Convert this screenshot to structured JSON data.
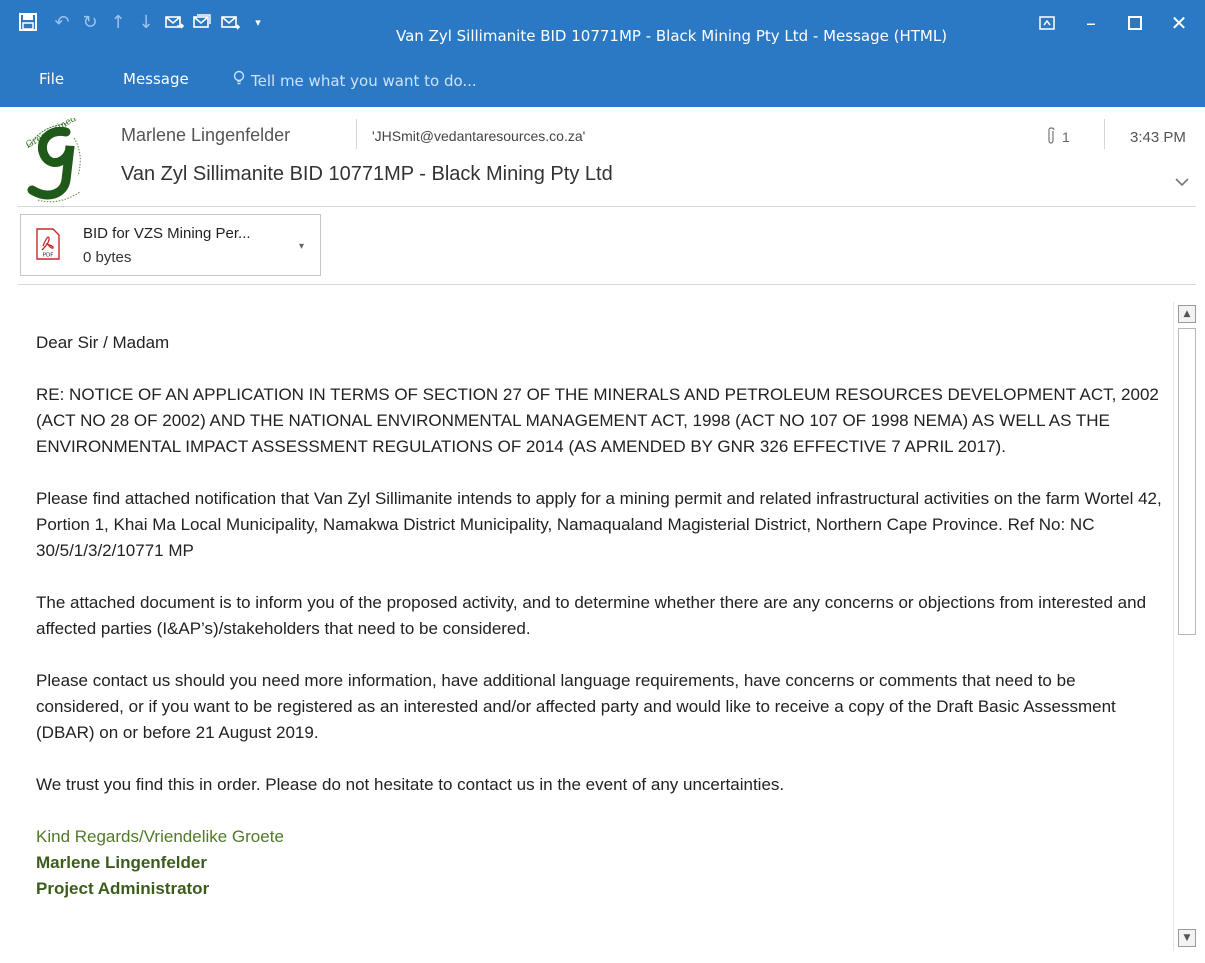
{
  "window": {
    "title": "Van Zyl Sillimanite BID 10771MP - Black Mining Pty Ltd - Message (HTML)",
    "accent": "#2b78c5"
  },
  "quick_access": [
    {
      "icon": "save-icon"
    },
    {
      "icon": "undo-icon"
    },
    {
      "icon": "redo-icon"
    },
    {
      "icon": "up-arrow-icon"
    },
    {
      "icon": "down-arrow-icon"
    },
    {
      "icon": "reply-icon"
    },
    {
      "icon": "reply-all-icon"
    },
    {
      "icon": "forward-icon"
    },
    {
      "icon": "customize-dropdown-icon"
    }
  ],
  "ribbon": {
    "tabs": [
      "File",
      "Message"
    ],
    "tell_me": "Tell me what you want to do..."
  },
  "message": {
    "sender": "Marlene Lingenfelder",
    "recipient": "'JHSmit@vedantaresources.co.za'",
    "subject": "Van Zyl Sillimanite BID 10771MP - Black Mining Pty Ltd",
    "attachment_count": "1",
    "time": "3:43 PM"
  },
  "attachment": {
    "name": "BID for VZS Mining Per...",
    "size": "0 bytes",
    "type_label": "PDF"
  },
  "body": {
    "greeting": "Dear Sir / Madam",
    "paragraphs": [
      "RE: NOTICE OF AN APPLICATION IN TERMS OF SECTION 27 OF THE MINERALS AND PETROLEUM RESOURCES DEVELOPMENT ACT, 2002 (ACT NO 28 OF 2002) AND THE NATIONAL ENVIRONMENTAL MANAGEMENT ACT, 1998 (ACT NO 107 OF 1998 NEMA) AS WELL AS THE ENVIRONMENTAL IMPACT ASSESSMENT REGULATIONS OF 2014 (AS AMENDED BY GNR 326 EFFECTIVE 7 APRIL 2017).",
      "Please find attached notification that Van Zyl Sillimanite intends to apply for a mining permit and related infrastructural activities on the farm Wortel 42, Portion 1, Khai Ma Local Municipality, Namakwa District Municipality, Namaqualand Magisterial District, Northern Cape Province. Ref No: NC 30/5/1/3/2/10771 MP",
      "The attached document is to inform you of the proposed activity, and to determine whether there are any concerns or objections from interested and affected parties (I&AP’s)/stakeholders that need to be considered.",
      "Please contact us should you need more information, have additional language requirements, have concerns or comments that need to be considered, or if you want to be registered as an interested and/or affected party and would like to receive a copy of the Draft Basic Assessment (DBAR) on or before 21 August 2019.",
      "We trust you find this in order.  Please do not hesitate to contact us in the event of any uncertainties."
    ],
    "signoff": "Kind Regards/Vriendelike Groete",
    "sig_name": "Marlene Lingenfelder",
    "sig_title": "Project Administrator",
    "signature_color": "#4f7a28"
  }
}
